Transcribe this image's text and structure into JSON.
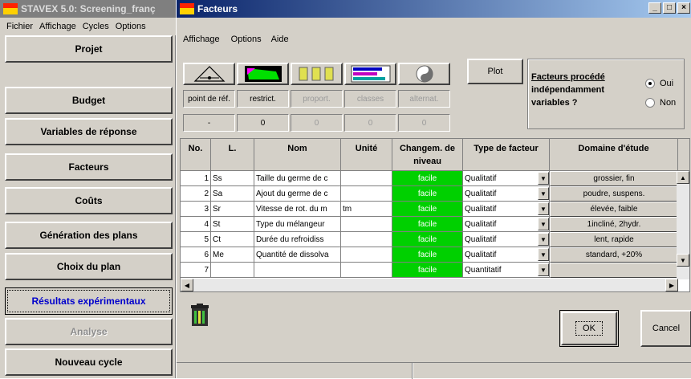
{
  "main_window": {
    "title": "STAVEX 5.0: Screening_franç",
    "menu": [
      "Fichier",
      "Affichage",
      "Cycles",
      "Options"
    ]
  },
  "nav": [
    {
      "label": "Projet",
      "state": "normal"
    },
    {
      "label": "Budget",
      "state": "normal"
    },
    {
      "label": "Variables de réponse",
      "state": "normal"
    },
    {
      "label": "Facteurs",
      "state": "normal"
    },
    {
      "label": "Coûts",
      "state": "normal"
    },
    {
      "label": "Génération des plans",
      "state": "normal"
    },
    {
      "label": "Choix du plan",
      "state": "normal"
    },
    {
      "label": "Résultats expérimentaux",
      "state": "active"
    },
    {
      "label": "Analyse",
      "state": "disabled"
    },
    {
      "label": "Nouveau cycle",
      "state": "normal"
    }
  ],
  "dialog": {
    "title": "Facteurs",
    "menu": [
      "Affichage",
      "Options",
      "Aide"
    ],
    "tools": [
      {
        "icon": "reference-point-icon",
        "caption": "point de réf.",
        "count": "-",
        "enabled": true
      },
      {
        "icon": "restriction-icon",
        "caption": "restrict.",
        "count": "0",
        "enabled": true
      },
      {
        "icon": "proportion-icon",
        "caption": "proport.",
        "count": "0",
        "enabled": false
      },
      {
        "icon": "classes-icon",
        "caption": "classes",
        "count": "0",
        "enabled": false
      },
      {
        "icon": "alternative-icon",
        "caption": "alternat.",
        "count": "0",
        "enabled": false
      }
    ],
    "plot_label": "Plot",
    "group": {
      "label_line1": "Facteurs procédé",
      "label_line2": "indépendamment",
      "label_line3": "variables ?",
      "yes": "Oui",
      "no": "Non",
      "selected": "yes"
    },
    "table": {
      "headers": [
        "No.",
        "L.",
        "Nom",
        "Unité",
        "Changem. de niveau",
        "Type de facteur",
        "Domaine d'étude"
      ],
      "rows": [
        {
          "no": "1",
          "l": "Ss",
          "nom": "Taille du germe de c",
          "unite": "",
          "change": "facile",
          "type": "Qualitatif",
          "domaine": "grossier, fin"
        },
        {
          "no": "2",
          "l": "Sa",
          "nom": "Ajout du germe de c",
          "unite": "",
          "change": "facile",
          "type": "Qualitatif",
          "domaine": "poudre, suspens."
        },
        {
          "no": "3",
          "l": "Sr",
          "nom": "Vitesse de rot. du m",
          "unite": "tm",
          "change": "facile",
          "type": "Qualitatif",
          "domaine": "élevée, faible"
        },
        {
          "no": "4",
          "l": "St",
          "nom": "Type du mélangeur",
          "unite": "",
          "change": "facile",
          "type": "Qualitatif",
          "domaine": "1incliné, 2hydr."
        },
        {
          "no": "5",
          "l": "Ct",
          "nom": "Durée du refroidiss",
          "unite": "",
          "change": "facile",
          "type": "Qualitatif",
          "domaine": "lent, rapide"
        },
        {
          "no": "6",
          "l": "Me",
          "nom": "Quantité de dissolva",
          "unite": "",
          "change": "facile",
          "type": "Qualitatif",
          "domaine": "standard, +20%"
        },
        {
          "no": "7",
          "l": "",
          "nom": "",
          "unite": "",
          "change": "facile",
          "type": "Quantitatif",
          "domaine": ""
        }
      ]
    },
    "ok_label": "OK",
    "cancel_label": "Cancel"
  },
  "colors": {
    "active_title": "#0a246a",
    "inactive_title": "#7f7f7f",
    "facile_green": "#00d000",
    "face": "#d4d0c8"
  }
}
